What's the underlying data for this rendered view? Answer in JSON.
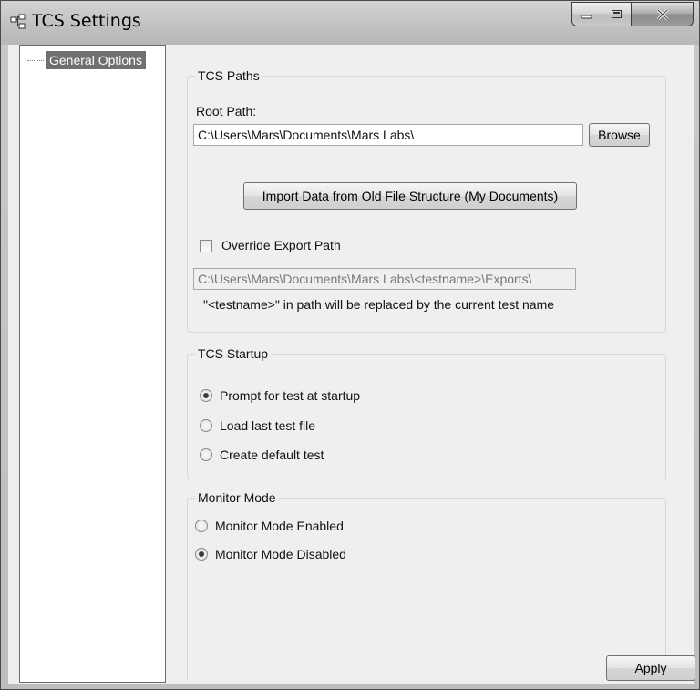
{
  "window": {
    "title": "TCS Settings"
  },
  "tree": {
    "items": [
      {
        "label": "General Options",
        "selected": true
      }
    ]
  },
  "paths": {
    "group_title": "TCS Paths",
    "root_label": "Root Path:",
    "root_value": "C:\\Users\\Mars\\Documents\\Mars Labs\\",
    "browse_label": "Browse",
    "import_label": "Import Data from Old File Structure (My Documents)",
    "override_label": "Override Export Path",
    "override_checked": false,
    "export_value": "C:\\Users\\Mars\\Documents\\Mars Labs\\<testname>\\Exports\\",
    "note": "\"<testname>\" in path will be replaced by the current test name"
  },
  "startup": {
    "group_title": "TCS Startup",
    "options": [
      {
        "label": "Prompt for test at startup",
        "checked": true
      },
      {
        "label": "Load last test file",
        "checked": false
      },
      {
        "label": "Create default test",
        "checked": false
      }
    ]
  },
  "monitor": {
    "group_title": "Monitor Mode",
    "options": [
      {
        "label": "Monitor Mode Enabled",
        "checked": false
      },
      {
        "label": "Monitor Mode Disabled",
        "checked": true
      }
    ]
  },
  "footer": {
    "apply_label": "Apply"
  }
}
